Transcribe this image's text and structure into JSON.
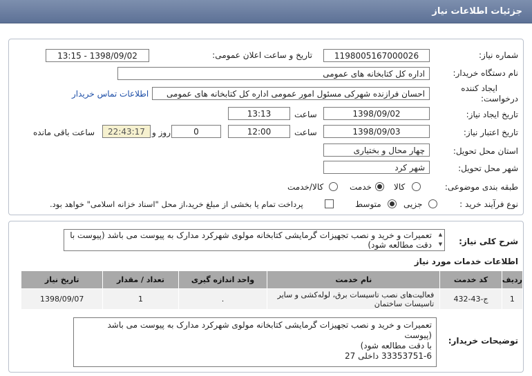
{
  "header": {
    "title": "جزئیات اطلاعات نیاز"
  },
  "form": {
    "need_number_label": "شماره نیاز:",
    "need_number": "1198005167000026",
    "announce_label": "تاریخ و ساعت اعلان عمومی:",
    "announce_value": "1398/09/02 - 13:15",
    "buyer_label": "نام دستگاه خریدار:",
    "buyer_value": "اداره کل کتابخانه های عمومی",
    "creator_label_1": "ایجاد کننده",
    "creator_label_2": "درخواست:",
    "creator_value": "احسان فرازنده شهرکی مسئول امور عمومی اداره کل کتابخانه های عمومی",
    "contact_link": "اطلاعات تماس خریدار",
    "created_date_label": "تاریخ ایجاد نیاز:",
    "created_date": "1398/09/02",
    "time_label": "ساعت",
    "created_time": "13:13",
    "valid_date_label": "تاریخ اعتبار نیاز:",
    "valid_date": "1398/09/03",
    "valid_time": "12:00",
    "days_value": "0",
    "days_label": "روز و",
    "remaining_time": "22:43:17",
    "remaining_label": "ساعت باقی مانده",
    "province_label": "استان محل تحویل:",
    "province_value": "چهار محال و بختیاری",
    "city_label": "شهر محل تحویل:",
    "city_value": "شهر کرد",
    "category_label": "طبقه بندی موضوعی:",
    "category_options": [
      "کالا",
      "خدمت",
      "کالا/خدمت"
    ],
    "process_label": "نوع فرآیند خرید :",
    "process_options": [
      "جزیی",
      "متوسط"
    ],
    "payment_note": "پرداخت تمام یا بخشی از مبلغ خرید،از محل \"اسناد خزانه اسلامی\" خواهد بود."
  },
  "summary": {
    "label": "شرح کلی نیاز:",
    "text": "تعمیرات و خرید و نصب تجهیزات گرمایشی کتابخانه مولوی شهرکرد مدارک به پیوست می باشد (پیوست با دقت مطالعه شود)"
  },
  "services": {
    "title": "اطلاعات خدمات مورد نیاز",
    "columns": [
      "ردیف",
      "کد خدمت",
      "نام خدمت",
      "واحد اندازه گیری",
      "تعداد / مقدار",
      "تاریخ نیاز"
    ],
    "rows": [
      [
        "1",
        "ج-43-432",
        "فعالیت‌های نصب تاسیسات برق، لوله‌کشی و سایر تاسیسات ساختمان",
        ".",
        "1",
        "1398/09/07"
      ]
    ]
  },
  "buyer_notes": {
    "label": "توضیحات خریدار:",
    "line1": "تعمیرات و خرید و نصب تجهیزات گرمایشی کتابخانه مولوی شهرکرد مدارک به پیوست می باشد (پیوست",
    "line2": "با دقت مطالعه شود)",
    "line3": "33353751-6 داخلی 27"
  }
}
